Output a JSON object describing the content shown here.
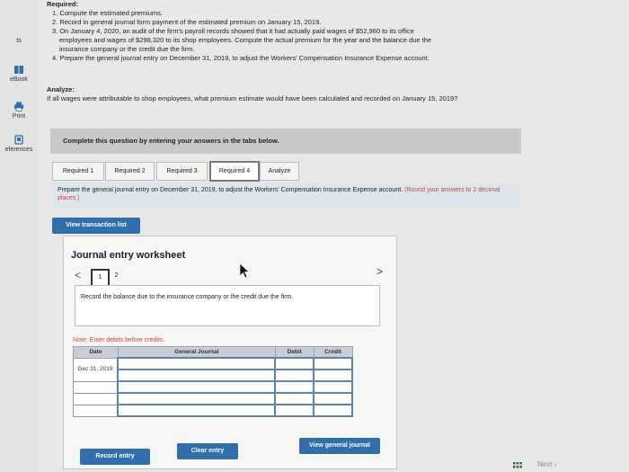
{
  "sidebar": {
    "top_label": "ts",
    "items": [
      {
        "label": "eBook",
        "icon": "book-icon"
      },
      {
        "label": "Print",
        "icon": "printer-icon"
      },
      {
        "label": "eferences",
        "icon": "references-icon"
      }
    ]
  },
  "required": {
    "title": "Required:",
    "items": [
      "1. Compute the estimated premiums.",
      "2. Record in general journal form payment of the estimated premium on January 15, 2019.",
      "3. On January 4, 2020, an audit of the firm's payroll records showed that it had actually paid wages of $52,960 to its office",
      "employees and wages of $298,320 to its shop employees. Compute the actual premium for the year and the balance due the",
      "insurance company or the credit due the firm.",
      "4. Prepare the general journal entry on December 31, 2019, to adjust the Workers' Compensation Insurance Expense account."
    ]
  },
  "analyze": {
    "title": "Analyze:",
    "text": "If all wages were attributable to shop employees, what premium estimate would have been calculated and recorded on January 15, 2019?"
  },
  "banner": "Complete this question by entering your answers in the tabs below.",
  "tabs": [
    "Required 1",
    "Required 2",
    "Required 3",
    "Required 4",
    "Analyze"
  ],
  "active_tab": "Required 4",
  "instruction": {
    "text": "Prepare the general journal entry on December 31, 2019, to adjust the Workers' Compensation Insurance Expense account.",
    "note": "(Round your answers to 2 decimal places.)"
  },
  "view_transaction_list": "View transaction list",
  "worksheet": {
    "title": "Journal entry worksheet",
    "prev": "<",
    "next": ">",
    "pages": [
      "1",
      "2"
    ],
    "description": "Record the balance due to the insurance company or the credit due the firm.",
    "note": "Note: Enter debits before credits.",
    "columns": [
      "Date",
      "General Journal",
      "Debit",
      "Credit"
    ],
    "date_value": "Dec 31, 2019",
    "record_entry": "Record entry",
    "clear_entry": "Clear entry",
    "view_general_journal": "View general journal"
  },
  "footer": {
    "next": "Next"
  }
}
